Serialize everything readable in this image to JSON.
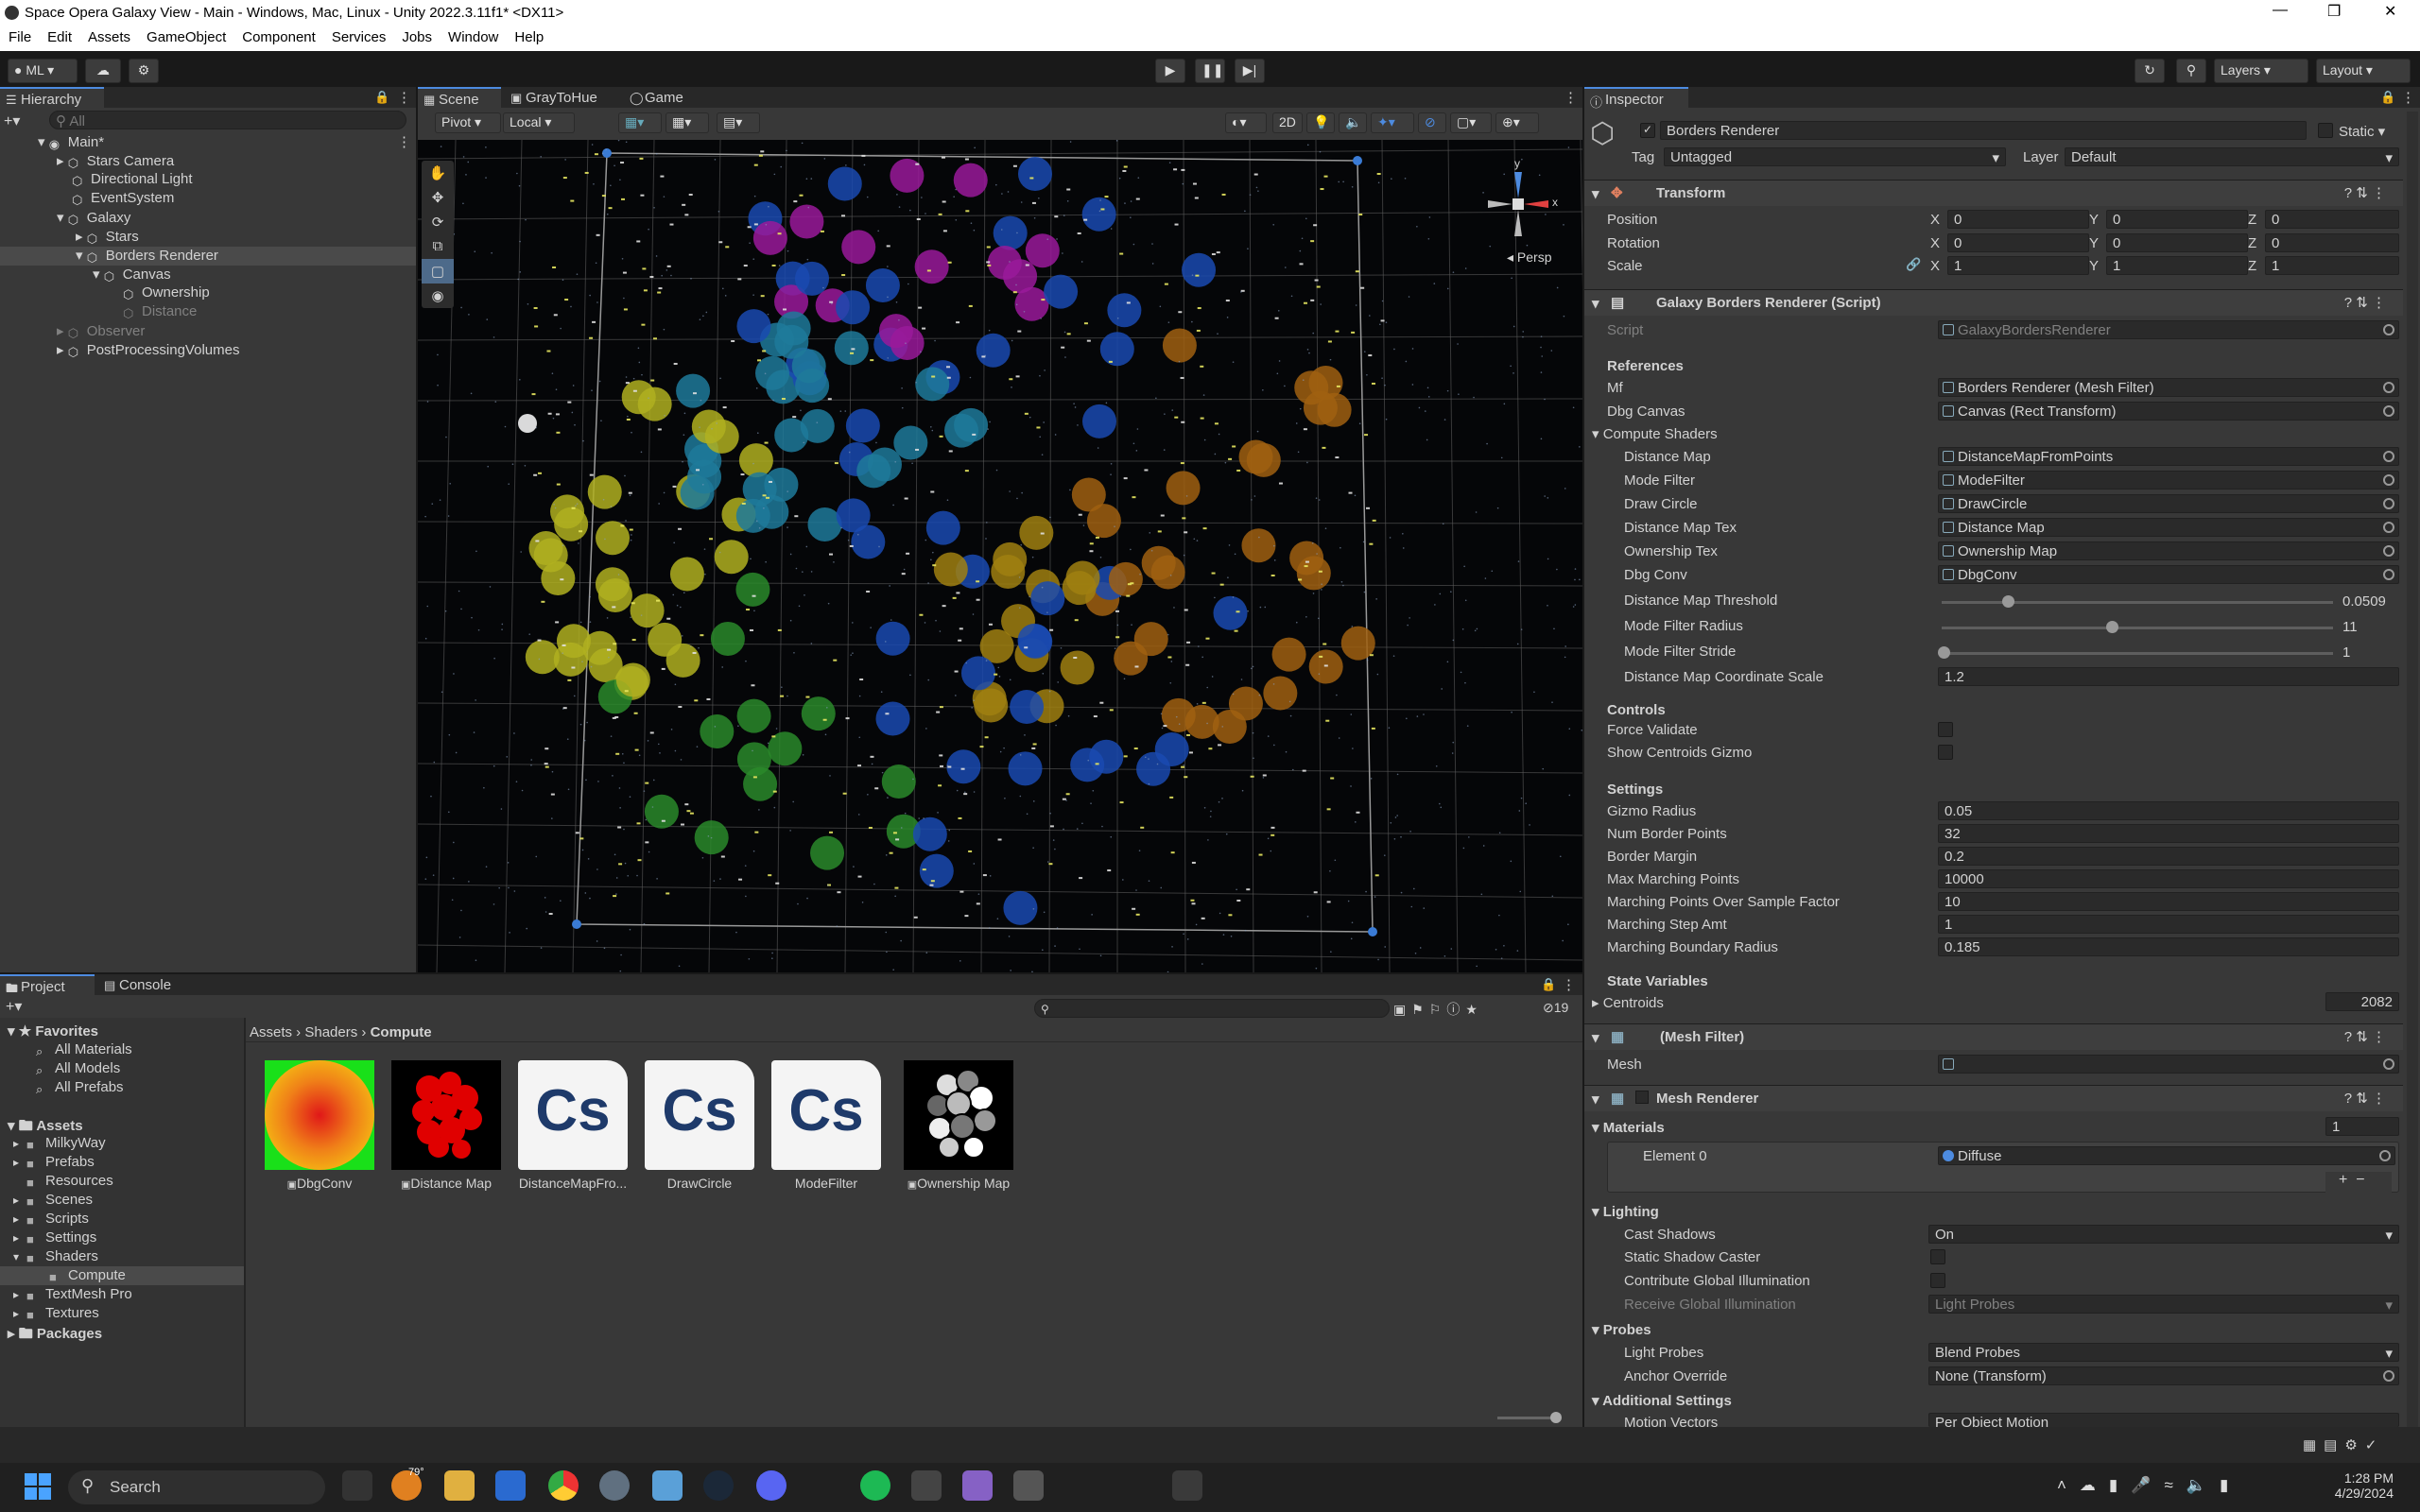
{
  "window": {
    "title": "Space Opera Galaxy View - Main - Windows, Mac, Linux - Unity 2022.3.11f1* <DX11>"
  },
  "menu": [
    "File",
    "Edit",
    "Assets",
    "GameObject",
    "Component",
    "Services",
    "Jobs",
    "Window",
    "Help"
  ],
  "toolbar": {
    "account": "ML",
    "layers": "Layers",
    "layout": "Layout"
  },
  "hierarchy": {
    "tab": "Hierarchy",
    "search_placeholder": "All",
    "items": [
      {
        "label": "Main*"
      },
      {
        "label": "Stars Camera"
      },
      {
        "label": "Directional Light"
      },
      {
        "label": "EventSystem"
      },
      {
        "label": "Galaxy"
      },
      {
        "label": "Stars"
      },
      {
        "label": "Borders Renderer"
      },
      {
        "label": "Canvas"
      },
      {
        "label": "Ownership"
      },
      {
        "label": "Distance"
      },
      {
        "label": "Observer"
      },
      {
        "label": "PostProcessingVolumes"
      }
    ]
  },
  "scene": {
    "tabs": [
      "Scene",
      "GrayToHue",
      "Game"
    ],
    "pivot": "Pivot",
    "local": "Local",
    "mode2d": "2D",
    "persp": "Persp",
    "axis_x": "x",
    "axis_y": "y"
  },
  "inspector": {
    "tab": "Inspector",
    "object_name": "Borders Renderer",
    "static": "Static",
    "tag_label": "Tag",
    "tag": "Untagged",
    "layer_label": "Layer",
    "layer": "Default",
    "transform": {
      "title": "Transform",
      "position": "Position",
      "rotation": "Rotation",
      "scale": "Scale",
      "pos": [
        "0",
        "0",
        "0"
      ],
      "rot": [
        "0",
        "0",
        "0"
      ],
      "scl": [
        "1",
        "1",
        "1"
      ],
      "x": "X",
      "y": "Y",
      "z": "Z"
    },
    "script_comp": {
      "title": "Galaxy Borders Renderer (Script)",
      "script_label": "Script",
      "script": "GalaxyBordersRenderer",
      "references": "References",
      "mf_label": "Mf",
      "mf": "Borders Renderer (Mesh Filter)",
      "dbg_label": "Dbg Canvas",
      "dbg": "Canvas (Rect Transform)",
      "compute": "Compute Shaders",
      "shader_rows": [
        {
          "label": "Distance Map",
          "value": "DistanceMapFromPoints"
        },
        {
          "label": "Mode Filter",
          "value": "ModeFilter"
        },
        {
          "label": "Draw Circle",
          "value": "DrawCircle"
        },
        {
          "label": "Distance Map Tex",
          "value": "Distance Map"
        },
        {
          "label": "Ownership Tex",
          "value": "Ownership Map"
        },
        {
          "label": "Dbg Conv",
          "value": "DbgConv"
        }
      ],
      "threshold_label": "Distance Map Threshold",
      "threshold": "0.0509",
      "radius_label": "Mode Filter Radius",
      "radius": "11",
      "stride_label": "Mode Filter Stride",
      "stride": "1",
      "coord_label": "Distance Map Coordinate Scale",
      "coord": "1.2",
      "controls": "Controls",
      "force_validate": "Force Validate",
      "show_gizmo": "Show Centroids Gizmo",
      "settings": "Settings",
      "settings_rows": [
        {
          "label": "Gizmo Radius",
          "value": "0.05"
        },
        {
          "label": "Num Border Points",
          "value": "32"
        },
        {
          "label": "Border Margin",
          "value": "0.2"
        },
        {
          "label": "Max Marching Points",
          "value": "10000"
        },
        {
          "label": "Marching Points Over Sample Factor",
          "value": "10"
        },
        {
          "label": "Marching Step Amt",
          "value": "1"
        },
        {
          "label": "Marching Boundary Radius",
          "value": "0.185"
        }
      ],
      "state": "State Variables",
      "centroids_label": "Centroids",
      "centroids": "2082"
    },
    "mesh_filter": {
      "title": "(Mesh Filter)",
      "mesh_label": "Mesh"
    },
    "mesh_renderer": {
      "title": "Mesh Renderer",
      "materials": "Materials",
      "count": "1",
      "element": "Element 0",
      "material": "Diffuse",
      "lighting": "Lighting",
      "cast_label": "Cast Shadows",
      "cast": "On",
      "static_caster": "Static Shadow Caster",
      "contrib": "Contribute Global Illumination",
      "receive_label": "Receive Global Illumination",
      "receive": "Light Probes",
      "probes": "Probes",
      "lp_label": "Light Probes",
      "lp": "Blend Probes",
      "anchor_label": "Anchor Override",
      "anchor": "None (Transform)",
      "additional": "Additional Settings",
      "motion_label": "Motion Vectors",
      "motion": "Per Object Motion"
    }
  },
  "project": {
    "tabs": [
      "Project",
      "Console"
    ],
    "favorites": "Favorites",
    "fav_items": [
      "All Materials",
      "All Models",
      "All Prefabs"
    ],
    "assets": "Assets",
    "folders": [
      "MilkyWay",
      "Prefabs",
      "Resources",
      "Scenes",
      "Scripts",
      "Settings",
      "Shaders",
      "Compute",
      "TextMesh Pro",
      "Textures"
    ],
    "packages": "Packages",
    "breadcrumb": [
      "Assets",
      "Shaders",
      "Compute"
    ],
    "count": "19",
    "files": [
      {
        "name": "DbgConv"
      },
      {
        "name": "Distance Map"
      },
      {
        "name": "DistanceMapFro..."
      },
      {
        "name": "DrawCircle"
      },
      {
        "name": "ModeFilter"
      },
      {
        "name": "Ownership Map"
      }
    ],
    "cs": "Cs"
  },
  "taskbar": {
    "search": "Search",
    "temp": "79°",
    "time": "1:28 PM",
    "date": "4/29/2024"
  }
}
